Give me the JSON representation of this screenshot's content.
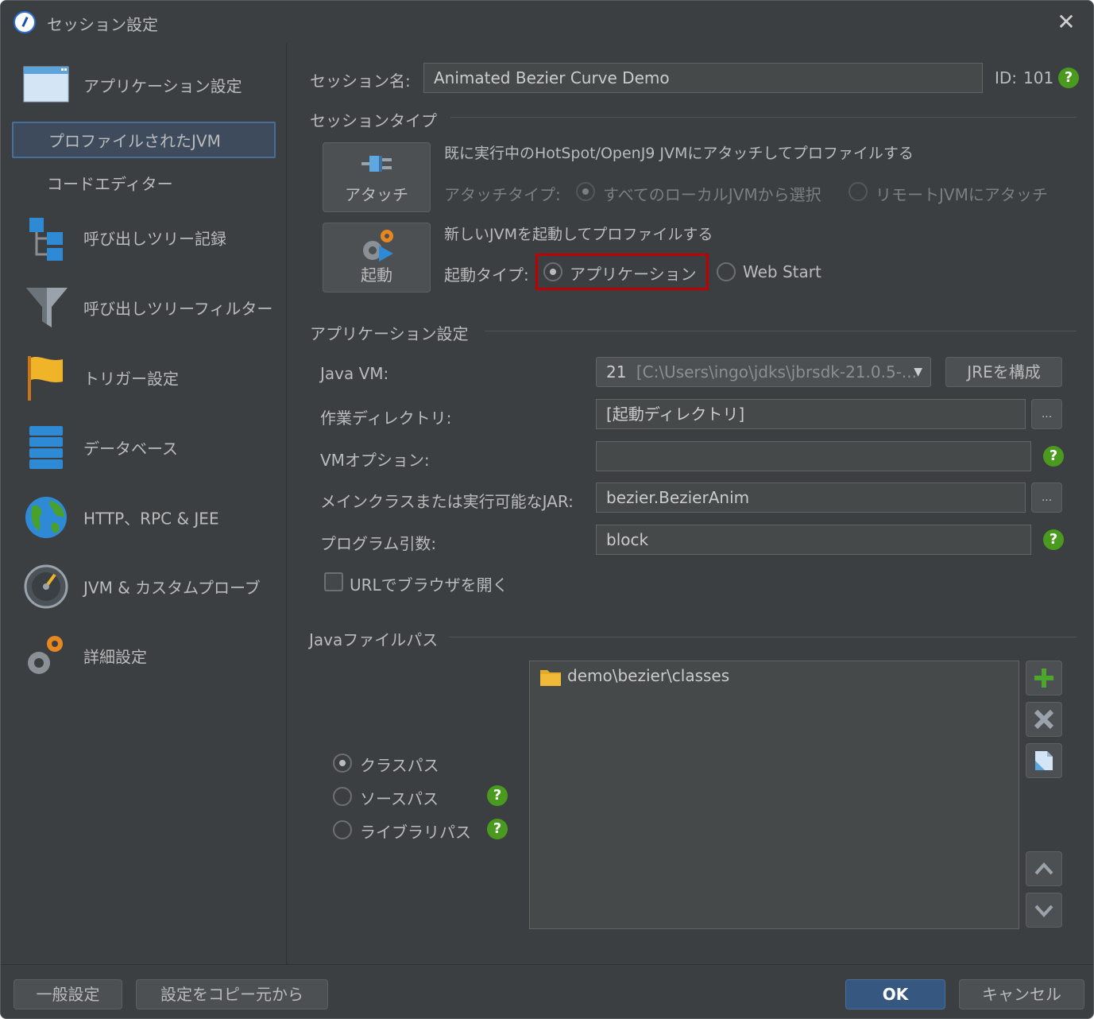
{
  "window": {
    "title": "セッション設定",
    "close_glyph": "✕"
  },
  "sidebar": {
    "items": [
      {
        "label": "アプリケーション設定",
        "icon": "window-icon"
      },
      {
        "label": "プロファイルされたJVM",
        "selected": true
      },
      {
        "label": "コードエディター"
      },
      {
        "label": "呼び出しツリー記録",
        "icon": "tree-icon"
      },
      {
        "label": "呼び出しツリーフィルター",
        "icon": "funnel-icon"
      },
      {
        "label": "トリガー設定",
        "icon": "flag-icon"
      },
      {
        "label": "データベース",
        "icon": "database-icon"
      },
      {
        "label": "HTTP、RPC & JEE",
        "icon": "globe-icon"
      },
      {
        "label": "JVM & カスタムプローブ",
        "icon": "gauge-icon"
      },
      {
        "label": "詳細設定",
        "icon": "gears-icon"
      }
    ]
  },
  "session": {
    "name_label": "セッション名:",
    "name_value": "Animated Bezier Curve Demo",
    "id_label": "ID:",
    "id_value": "101"
  },
  "session_type": {
    "heading": "セッションタイプ",
    "attach_button": "アタッチ",
    "attach_desc": "既に実行中のHotSpot/OpenJ9 JVMにアタッチしてプロファイルする",
    "attach_type_label": "アタッチタイプ:",
    "attach_local": "すべてのローカルJVMから選択",
    "attach_remote": "リモートJVMにアタッチ",
    "launch_button": "起動",
    "launch_desc": "新しいJVMを起動してプロファイルする",
    "launch_type_label": "起動タイプ:",
    "launch_app": "アプリケーション",
    "launch_webstart": "Web Start"
  },
  "app_settings": {
    "heading": "アプリケーション設定",
    "java_vm_label": "Java VM:",
    "java_vm_version": "21",
    "java_vm_path": "[C:\\Users\\ingo\\jdks\\jbrsdk-21.0.5-...",
    "jre_button": "JREを構成",
    "workdir_label": "作業ディレクトリ:",
    "workdir_value": "[起動ディレクトリ]",
    "vmopts_label": "VMオプション:",
    "vmopts_value": "",
    "mainclass_label": "メインクラスまたは実行可能なJAR:",
    "mainclass_value": "bezier.BezierAnim",
    "args_label": "プログラム引数:",
    "args_value": "block",
    "browse_glyph": "...",
    "url_checkbox": "URLでブラウザを開く"
  },
  "java_path": {
    "heading": "Javaファイルパス",
    "classpath": "クラスパス",
    "sourcepath": "ソースパス",
    "librarypath": "ライブラリパス",
    "entries": [
      "demo\\bezier\\classes"
    ]
  },
  "footer": {
    "general": "一般設定",
    "copy": "設定をコピー元から",
    "ok": "OK",
    "cancel": "キャンセル"
  },
  "colors": {
    "background": "#3c3f41",
    "field": "#45494a",
    "accent": "#365880",
    "help": "#4a9a1f",
    "highlight": "#c00000"
  }
}
